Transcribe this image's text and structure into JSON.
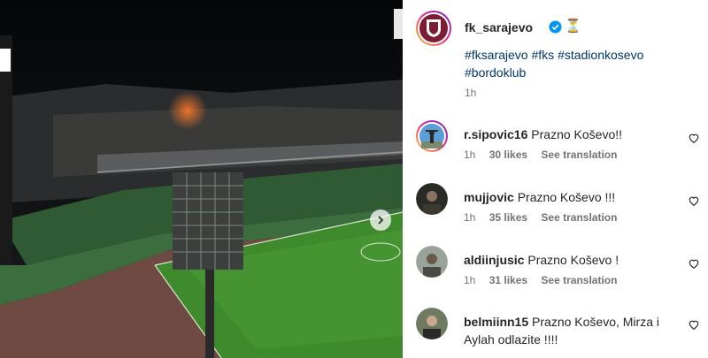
{
  "post": {
    "username": "fk_sarajevo",
    "verified_icon": "verified-badge-icon",
    "emoji": "⏳",
    "hashtags": [
      "#fksarajevo",
      "#fks",
      "#stadionkosevo",
      "#bordoklub"
    ],
    "time": "1h"
  },
  "comments": [
    {
      "user": "r.sipovic16",
      "text": "Prazno Koševo!!",
      "time": "1h",
      "likes": "30 likes",
      "translate": "See translation"
    },
    {
      "user": "mujjovic",
      "text": "Prazno Koševo !!!",
      "time": "1h",
      "likes": "35 likes",
      "translate": "See translation"
    },
    {
      "user": "aldiinjusic",
      "text": "Prazno Koševo !",
      "time": "1h",
      "likes": "31 likes",
      "translate": "See translation"
    },
    {
      "user": "belmiinn15",
      "text": "Prazno Koševo, Mirza i Aylah odlazite !!!!",
      "time": "",
      "likes": "",
      "translate": ""
    }
  ],
  "colors": {
    "brand": "#7b1e35",
    "link": "#00376b",
    "field": "#3f8a2d",
    "verified": "#0095f6"
  }
}
